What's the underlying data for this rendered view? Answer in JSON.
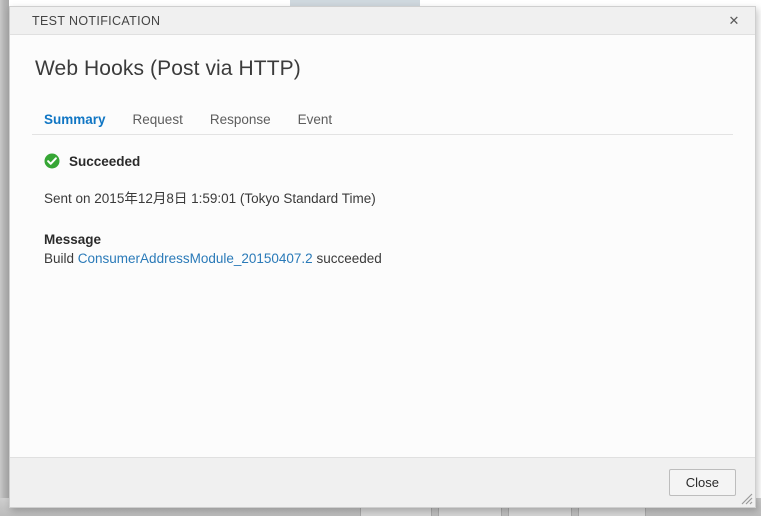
{
  "dialog": {
    "titlebar": {
      "title": "TEST NOTIFICATION",
      "close_icon": "close-icon",
      "close_glyph": "✕"
    },
    "heading": "Web Hooks (Post via HTTP)",
    "tabs": [
      {
        "label": "Summary",
        "active": true
      },
      {
        "label": "Request",
        "active": false
      },
      {
        "label": "Response",
        "active": false
      },
      {
        "label": "Event",
        "active": false
      }
    ],
    "summary": {
      "status_icon": "success-check-icon",
      "status_text": "Succeeded",
      "sent_line": "Sent on 2015年12月8日  1:59:01 (Tokyo Standard Time)",
      "message_label": "Message",
      "message_prefix": "Build ",
      "message_link": "ConsumerAddressModule_20150407.2",
      "message_suffix": " succeeded"
    },
    "footer": {
      "close_label": "Close",
      "resize_grip_icon": "resize-grip-icon"
    }
  },
  "colors": {
    "accent_blue": "#1076c4",
    "link_blue": "#2a7ab8",
    "success_green": "#36a635",
    "dialog_bg": "#fcfcfc",
    "chrome_gray": "#f0f0f0",
    "border_gray": "#e0e0e0"
  }
}
